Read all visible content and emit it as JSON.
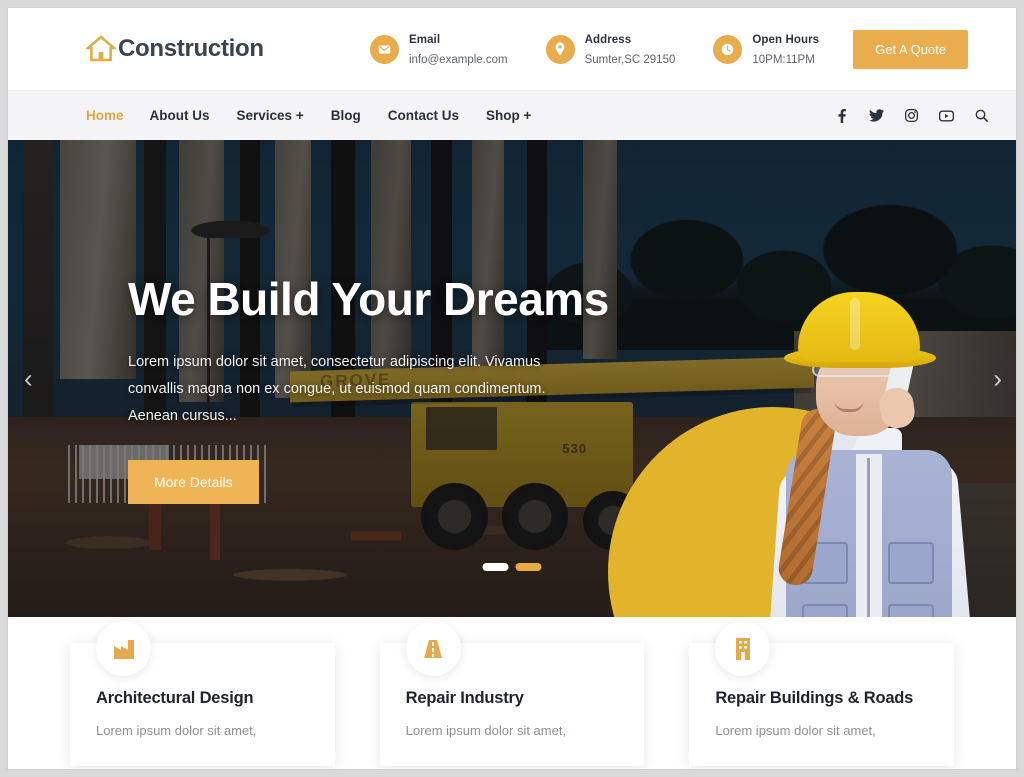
{
  "brand": {
    "name": "Construction",
    "icon": "home-icon",
    "accent": "#e9ad4e"
  },
  "contact": [
    {
      "icon": "envelope-icon",
      "title": "Email",
      "value": "info@example.com"
    },
    {
      "icon": "map-pin-icon",
      "title": "Address",
      "value": "Sumter,SC 29150"
    },
    {
      "icon": "clock-icon",
      "title": "Open Hours",
      "value": "10PM:11PM"
    }
  ],
  "header": {
    "quote_button": "Get A Quote"
  },
  "nav": {
    "items": [
      {
        "label": "Home",
        "active": true
      },
      {
        "label": "About Us",
        "active": false
      },
      {
        "label": "Services +",
        "active": false
      },
      {
        "label": "Blog",
        "active": false
      },
      {
        "label": "Contact Us",
        "active": false
      },
      {
        "label": "Shop +",
        "active": false
      }
    ],
    "social": [
      "facebook-icon",
      "twitter-icon",
      "instagram-icon",
      "youtube-icon",
      "search-icon"
    ]
  },
  "hero": {
    "title": "We Build Your Dreams",
    "text": "Lorem ipsum dolor sit amet, consectetur adipiscing elit. Vivamus convallis magna non ex congue, ut euismod quam condimentum. Aenean cursus...",
    "button": "More Details",
    "prev_arrow": "‹",
    "next_arrow": "›",
    "crane_brand": "GROVE",
    "crane_model": "530",
    "slides": [
      {
        "active": false
      },
      {
        "active": true
      }
    ]
  },
  "services": [
    {
      "icon": "factory-icon",
      "title": "Architectural Design",
      "text": "Lorem ipsum dolor sit amet,"
    },
    {
      "icon": "road-icon",
      "title": "Repair Industry",
      "text": "Lorem ipsum dolor sit amet,"
    },
    {
      "icon": "building-icon",
      "title": "Repair Buildings & Roads",
      "text": "Lorem ipsum dolor sit amet,"
    }
  ]
}
